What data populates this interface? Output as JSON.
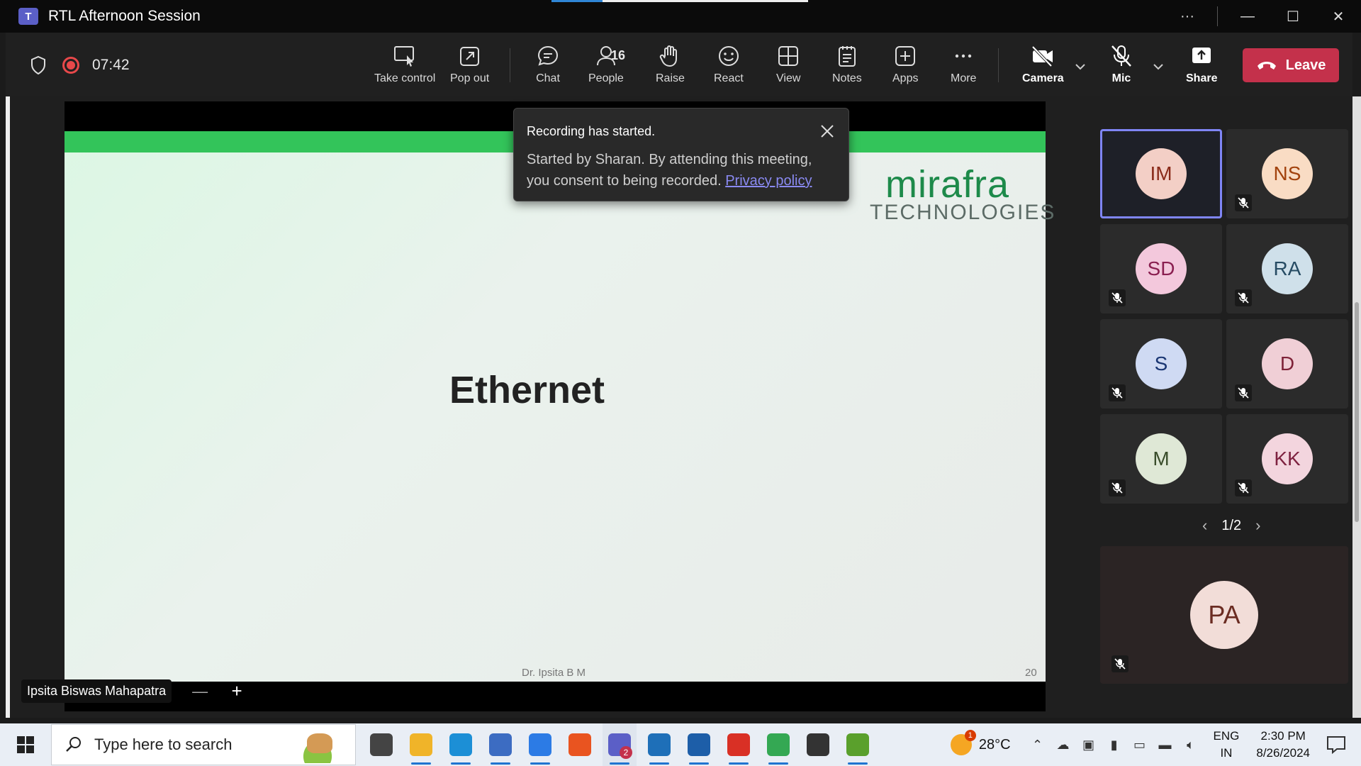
{
  "window": {
    "title": "RTL Afternoon Session",
    "app_icon_letter": "T",
    "controls": [
      "···",
      "—",
      "☐",
      "✕"
    ]
  },
  "toolbar": {
    "timer": "07:42",
    "people_count": "16",
    "tools": [
      {
        "label": "Take control",
        "icon": "take-control-icon"
      },
      {
        "label": "Pop out",
        "icon": "pop-out-icon"
      },
      {
        "label": "Chat",
        "icon": "chat-icon"
      },
      {
        "label": "People",
        "icon": "people-icon"
      },
      {
        "label": "Raise",
        "icon": "raise-hand-icon"
      },
      {
        "label": "React",
        "icon": "react-icon"
      },
      {
        "label": "View",
        "icon": "view-icon"
      },
      {
        "label": "Notes",
        "icon": "notes-icon"
      },
      {
        "label": "Apps",
        "icon": "apps-icon"
      },
      {
        "label": "More",
        "icon": "more-icon"
      },
      {
        "label": "Camera",
        "icon": "camera-off-icon"
      },
      {
        "label": "Mic",
        "icon": "mic-off-icon"
      },
      {
        "label": "Share",
        "icon": "share-icon"
      }
    ],
    "leave_label": "Leave"
  },
  "slide": {
    "logo_main": "mirafra",
    "logo_sub": "TECHNOLOGIES",
    "title": "Ethernet",
    "author": "Dr. Ipsita B M",
    "page": "20"
  },
  "presenter": {
    "name": "Ipsita Biswas Mahapatra",
    "zoom_out": "—",
    "zoom_in": "+"
  },
  "toast": {
    "title": "Recording has started.",
    "body": "Started by Sharan. By attending this meeting, you consent to being recorded.",
    "link": "Privacy policy"
  },
  "participants": [
    {
      "initials": "IM",
      "bg": "#f3cfc6",
      "fg": "#8a2b1a",
      "muted": false,
      "active": true
    },
    {
      "initials": "NS",
      "bg": "#f9dcc4",
      "fg": "#a2420d",
      "muted": true,
      "active": false
    },
    {
      "initials": "SD",
      "bg": "#f3c8dc",
      "fg": "#8a1f50",
      "muted": true,
      "active": false
    },
    {
      "initials": "RA",
      "bg": "#cfe0ea",
      "fg": "#264b63",
      "muted": true,
      "active": false
    },
    {
      "initials": "S",
      "bg": "#cfdaf3",
      "fg": "#1a3673",
      "muted": true,
      "active": false
    },
    {
      "initials": "D",
      "bg": "#f0cfd6",
      "fg": "#7e2238",
      "muted": true,
      "active": false
    },
    {
      "initials": "M",
      "bg": "#dfe8d6",
      "fg": "#3a4d2b",
      "muted": true,
      "active": false
    },
    {
      "initials": "KK",
      "bg": "#f3d5de",
      "fg": "#7e2240",
      "muted": true,
      "active": false
    }
  ],
  "pager": {
    "text": "1/2",
    "prev": "‹",
    "next": "›"
  },
  "featured": {
    "initials": "PA",
    "bg": "#f2ddd8",
    "fg": "#6b2c22",
    "muted": true
  },
  "taskbar": {
    "search_placeholder": "Type here to search",
    "teams_badge": "2",
    "weather_temp": "28°C",
    "weather_badge": "1",
    "lang_top": "ENG",
    "lang_bottom": "IN",
    "time": "2:30 PM",
    "date": "8/26/2024",
    "apps": [
      {
        "name": "task-view",
        "color": "#444"
      },
      {
        "name": "file-explorer",
        "color": "#f0b429"
      },
      {
        "name": "edge",
        "color": "#1c8fd6"
      },
      {
        "name": "network-app",
        "color": "#3c6cc2"
      },
      {
        "name": "remote-app",
        "color": "#2c7be5"
      },
      {
        "name": "ubuntu",
        "color": "#e95420"
      },
      {
        "name": "teams",
        "color": "#5b5fc7"
      },
      {
        "name": "photos",
        "color": "#1e6fb8"
      },
      {
        "name": "virtualbox",
        "color": "#1d5ea8"
      },
      {
        "name": "wps-office",
        "color": "#d93025"
      },
      {
        "name": "chrome",
        "color": "#34a853"
      },
      {
        "name": "penguin-app",
        "color": "#333333"
      },
      {
        "name": "editor-app",
        "color": "#5aa02c"
      }
    ]
  }
}
